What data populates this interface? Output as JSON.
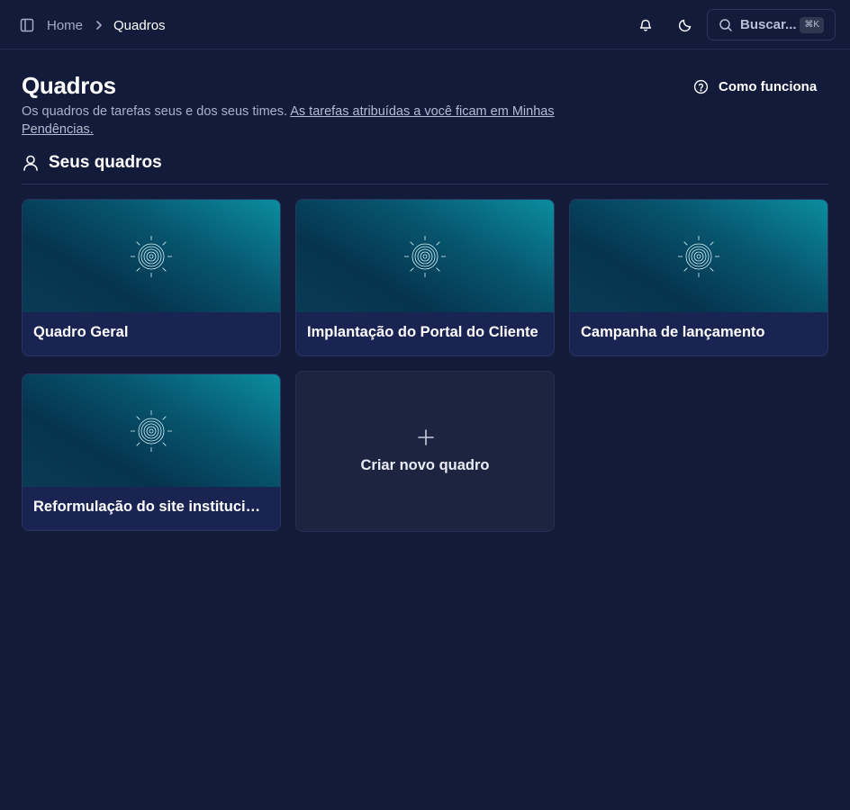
{
  "header": {
    "breadcrumb": {
      "home": "Home",
      "current": "Quadros"
    },
    "search": {
      "label": "Buscar...",
      "shortcut": "⌘K"
    }
  },
  "page": {
    "title": "Quadros",
    "subtitle_text": "Os quadros de tarefas seus e dos seus times.",
    "subtitle_link": "As tarefas atribuídas a você ficam em Minhas Pendências.",
    "help_button": "Como funciona"
  },
  "section": {
    "title": "Seus quadros"
  },
  "boards": [
    {
      "title": "Quadro Geral"
    },
    {
      "title": "Implantação do Portal do Cliente"
    },
    {
      "title": "Campanha de lançamento"
    },
    {
      "title": "Reformulação do site institucional"
    }
  ],
  "create_board": {
    "label": "Criar novo quadro"
  },
  "icons": {
    "sidebar_toggle": "sidebar-toggle-icon",
    "breadcrumb_separator": "chevron-right-icon",
    "notifications": "bell-icon",
    "theme": "moon-icon",
    "search": "search-icon",
    "help": "help-circle-icon",
    "section": "user-icon",
    "cover": "radial-target-icon",
    "create": "plus-icon"
  },
  "colors": {
    "background": "#131b3a",
    "card": "#192452",
    "cover_gradient_light": "#0b8d9f",
    "cover_gradient_dark": "#06344f",
    "muted_text": "#a8b1c9"
  }
}
